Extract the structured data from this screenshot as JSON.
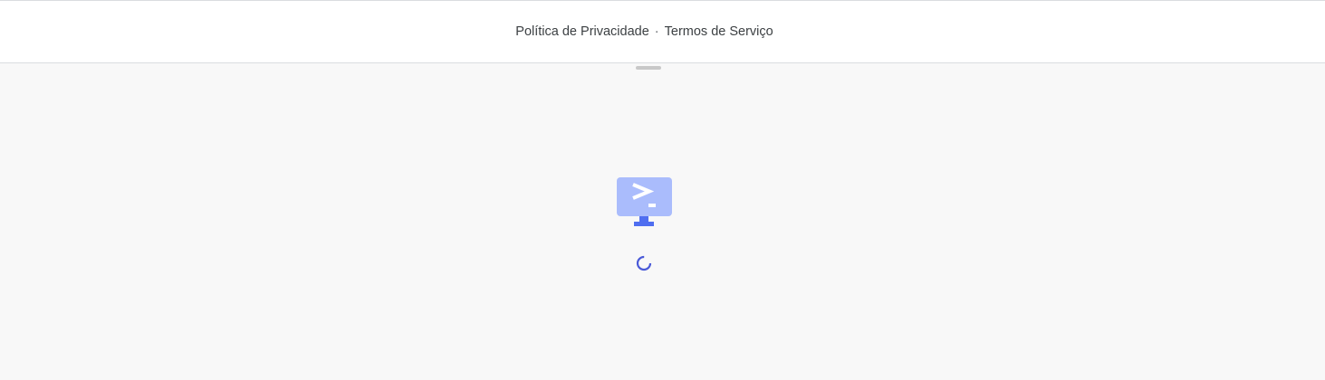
{
  "footer": {
    "privacy_label": "Política de Privacidade",
    "separator": "·",
    "terms_label": "Termos de Serviço"
  },
  "loading": {
    "icon": "terminal-monitor-icon",
    "spinner": "loading-spinner-icon"
  },
  "colors": {
    "monitor_screen": "#aabcfc",
    "monitor_stand": "#4f6ef0",
    "spinner": "#4a5ad8",
    "background": "#f8f8f8"
  }
}
